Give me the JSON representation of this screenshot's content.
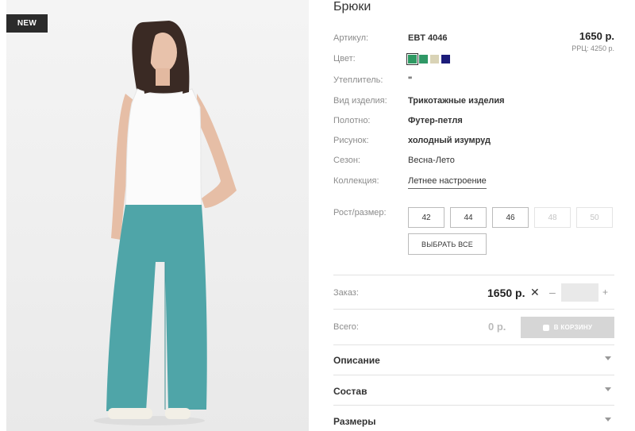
{
  "badge": "NEW",
  "product": {
    "title": "Брюки",
    "price": "1650 р.",
    "rrp": "РРЦ: 4250 р."
  },
  "specs": [
    {
      "label": "Артикул:",
      "value": "EBT 4046"
    },
    {
      "label": "Цвет:",
      "value": ""
    },
    {
      "label": "Утеплитель:",
      "value": "\""
    },
    {
      "label": "Вид изделия:",
      "value": "Трикотажные изделия"
    },
    {
      "label": "Полотно:",
      "value": "Футер-петля"
    },
    {
      "label": "Рисунок:",
      "value": "холодный изумруд"
    },
    {
      "label": "Сезон:",
      "value": "Весна-Лето"
    },
    {
      "label": "Коллекция:",
      "value": "Летнее настроение"
    }
  ],
  "colors": [
    {
      "hex": "#2e9a63",
      "selected": true,
      "icon": "color-swatch"
    },
    {
      "hex": "#2f9866",
      "selected": false,
      "icon": "color-swatch"
    },
    {
      "hex": "#d9d3b6",
      "selected": false,
      "icon": "color-swatch"
    },
    {
      "hex": "#1c1c7a",
      "selected": false,
      "icon": "color-swatch"
    }
  ],
  "sizes": {
    "label": "Рост/размер:",
    "options": [
      {
        "value": "42",
        "enabled": true
      },
      {
        "value": "44",
        "enabled": true
      },
      {
        "value": "46",
        "enabled": true
      },
      {
        "value": "48",
        "enabled": false
      },
      {
        "value": "50",
        "enabled": false
      }
    ],
    "select_all": "ВЫБРАТЬ ВСЕ"
  },
  "order": {
    "label": "Заказ:",
    "price": "1650 р.",
    "times": "✕",
    "minus": "–",
    "plus": "+",
    "qty": ""
  },
  "total": {
    "label": "Всего:",
    "value": "0 р.",
    "cart_button": "В КОРЗИНУ"
  },
  "accordion": [
    {
      "label": "Описание"
    },
    {
      "label": "Состав"
    },
    {
      "label": "Размеры"
    }
  ]
}
